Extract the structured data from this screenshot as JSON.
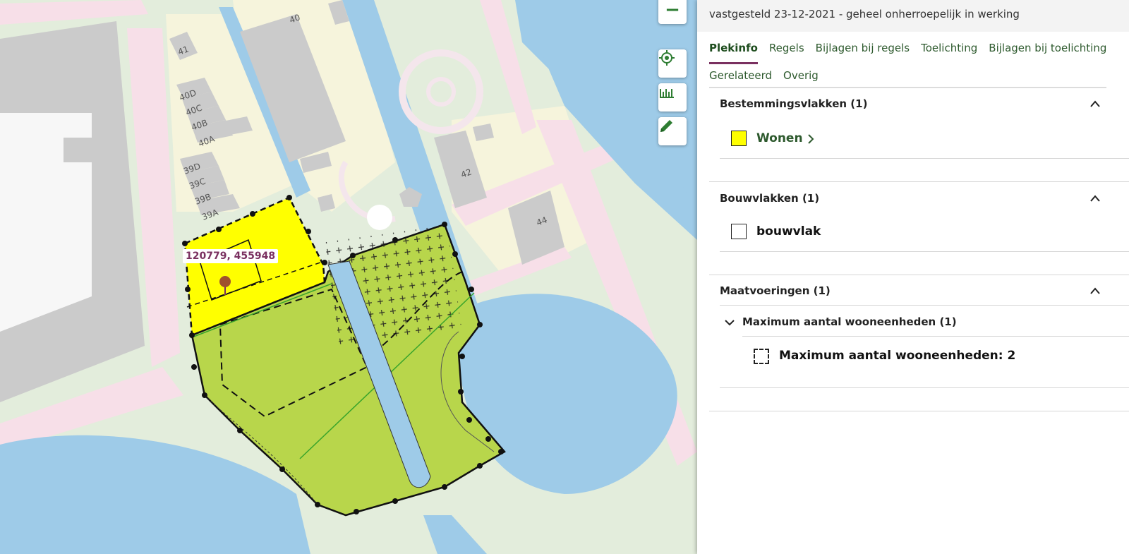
{
  "map": {
    "coordinate": "120779, 455948",
    "house_numbers": [
      "40",
      "41",
      "40D",
      "40C",
      "40B",
      "40A",
      "39D",
      "39C",
      "39B",
      "39A",
      "42",
      "44"
    ],
    "zoom_out_symbol": "−",
    "icons": [
      "zoom-out-icon",
      "locate-icon",
      "measure-icon",
      "draw-icon",
      "location-pin-icon"
    ],
    "colors": {
      "wonen": "#ffff00",
      "groen": "#b8d64b",
      "water": "#9ecbe8",
      "gebouw": "#cbcbcb",
      "accent": "#7a3060"
    }
  },
  "panel": {
    "status": "vastgesteld 23-12-2021 - geheel onherroepelijk in werking",
    "tabs": [
      "Plekinfo",
      "Regels",
      "Bijlagen bij regels",
      "Toelichting",
      "Bijlagen bij toelichting",
      "Gerelateerd",
      "Overig"
    ],
    "sections": [
      {
        "title": "Bestemmingsvlakken (1)",
        "item": "Wonen",
        "swatch": "#ffff00"
      },
      {
        "title": "Bouwvlakken (1)",
        "item": "bouwvlak",
        "swatch": "#ffffff"
      },
      {
        "title": "Maatvoeringen (1)",
        "subgroup": "Maximum aantal wooneenheden (1)",
        "item": "Maximum aantal wooneenheden: 2"
      }
    ],
    "colors": {
      "link": "#2e5a2e",
      "active_tab_underline": "#7a3060"
    }
  }
}
